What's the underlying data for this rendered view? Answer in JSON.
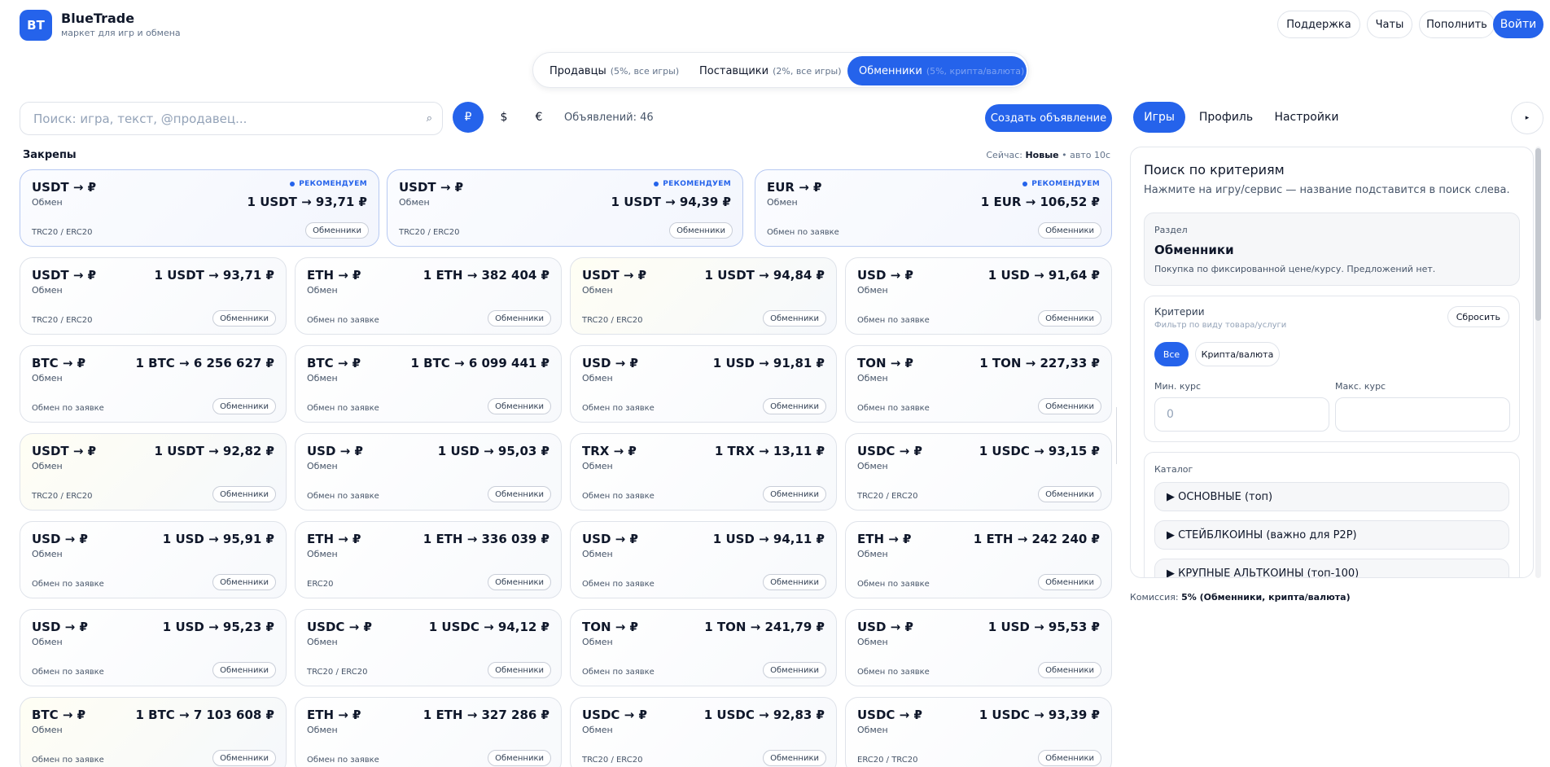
{
  "brand": {
    "logo": "BT",
    "name": "BlueTrade",
    "subtitle": "маркет для игр и обмена"
  },
  "header": {
    "support": "Поддержка",
    "chats": "Чаты",
    "topup": "Пополнить",
    "login": "Войти"
  },
  "modes": [
    {
      "label": "Продавцы",
      "hint": "(5%, все игры)"
    },
    {
      "label": "Поставщики",
      "hint": "(2%, все игры)"
    },
    {
      "label": "Обменники",
      "hint": "(5%, крипта/валюта)"
    }
  ],
  "search": {
    "placeholder": "Поиск: игра, текст, @продавец...",
    "icon": "search-icon"
  },
  "currencies": [
    "₽",
    "$",
    "€"
  ],
  "ads_count": "Объявлений: 46",
  "create_button": "Создать объявление",
  "pins": {
    "title": "Закрепы",
    "now_label": "Сейчас:",
    "sort_value": "Новые",
    "auto": "• авто 10с"
  },
  "recommend_label": "РЕКОМЕНДУЕМ",
  "pinned_cards": [
    {
      "pair": "USDT → ₽",
      "kind": "Обмен",
      "rate": "1 USDT → 93,71 ₽",
      "net": "TRC20 / ERC20",
      "tag": "Обменники"
    },
    {
      "pair": "USDT → ₽",
      "kind": "Обмен",
      "rate": "1 USDT → 94,39 ₽",
      "net": "TRC20 / ERC20",
      "tag": "Обменники"
    },
    {
      "pair": "EUR → ₽",
      "kind": "Обмен",
      "rate": "1 EUR → 106,52 ₽",
      "net": "Обмен по заявке",
      "tag": "Обменники"
    }
  ],
  "cards": [
    {
      "pair": "USDT → ₽",
      "kind": "Обмен",
      "rate": "1 USDT → 93,71 ₽",
      "net": "TRC20 / ERC20",
      "tag": "Обменники",
      "warm": false
    },
    {
      "pair": "ETH → ₽",
      "kind": "Обмен",
      "rate": "1 ETH → 382 404 ₽",
      "net": "Обмен по заявке",
      "tag": "Обменники",
      "warm": false
    },
    {
      "pair": "USDT → ₽",
      "kind": "Обмен",
      "rate": "1 USDT → 94,84 ₽",
      "net": "TRC20 / ERC20",
      "tag": "Обменники",
      "warm": true
    },
    {
      "pair": "USD → ₽",
      "kind": "Обмен",
      "rate": "1 USD → 91,64 ₽",
      "net": "Обмен по заявке",
      "tag": "Обменники",
      "warm": false
    },
    {
      "pair": "BTC → ₽",
      "kind": "Обмен",
      "rate": "1 BTC → 6 256 627 ₽",
      "net": "Обмен по заявке",
      "tag": "Обменники",
      "warm": false
    },
    {
      "pair": "BTC → ₽",
      "kind": "Обмен",
      "rate": "1 BTC → 6 099 441 ₽",
      "net": "Обмен по заявке",
      "tag": "Обменники",
      "warm": false
    },
    {
      "pair": "USD → ₽",
      "kind": "Обмен",
      "rate": "1 USD → 91,81 ₽",
      "net": "Обмен по заявке",
      "tag": "Обменники",
      "warm": false
    },
    {
      "pair": "TON → ₽",
      "kind": "Обмен",
      "rate": "1 TON → 227,33 ₽",
      "net": "Обмен по заявке",
      "tag": "Обменники",
      "warm": false
    },
    {
      "pair": "USDT → ₽",
      "kind": "Обмен",
      "rate": "1 USDT → 92,82 ₽",
      "net": "TRC20 / ERC20",
      "tag": "Обменники",
      "warm": true
    },
    {
      "pair": "USD → ₽",
      "kind": "Обмен",
      "rate": "1 USD → 95,03 ₽",
      "net": "Обмен по заявке",
      "tag": "Обменники",
      "warm": false
    },
    {
      "pair": "TRX → ₽",
      "kind": "Обмен",
      "rate": "1 TRX → 13,11 ₽",
      "net": "Обмен по заявке",
      "tag": "Обменники",
      "warm": false
    },
    {
      "pair": "USDC → ₽",
      "kind": "Обмен",
      "rate": "1 USDC → 93,15 ₽",
      "net": "TRC20 / ERC20",
      "tag": "Обменники",
      "warm": false
    },
    {
      "pair": "USD → ₽",
      "kind": "Обмен",
      "rate": "1 USD → 95,91 ₽",
      "net": "Обмен по заявке",
      "tag": "Обменники",
      "warm": false
    },
    {
      "pair": "ETH → ₽",
      "kind": "Обмен",
      "rate": "1 ETH → 336 039 ₽",
      "net": "ERC20",
      "tag": "Обменники",
      "warm": false
    },
    {
      "pair": "USD → ₽",
      "kind": "Обмен",
      "rate": "1 USD → 94,11 ₽",
      "net": "Обмен по заявке",
      "tag": "Обменники",
      "warm": false
    },
    {
      "pair": "ETH → ₽",
      "kind": "Обмен",
      "rate": "1 ETH → 242 240 ₽",
      "net": "Обмен по заявке",
      "tag": "Обменники",
      "warm": false
    },
    {
      "pair": "USD → ₽",
      "kind": "Обмен",
      "rate": "1 USD → 95,23 ₽",
      "net": "Обмен по заявке",
      "tag": "Обменники",
      "warm": false
    },
    {
      "pair": "USDC → ₽",
      "kind": "Обмен",
      "rate": "1 USDC → 94,12 ₽",
      "net": "TRC20 / ERC20",
      "tag": "Обменники",
      "warm": false
    },
    {
      "pair": "TON → ₽",
      "kind": "Обмен",
      "rate": "1 TON → 241,79 ₽",
      "net": "Обмен по заявке",
      "tag": "Обменники",
      "warm": false
    },
    {
      "pair": "USD → ₽",
      "kind": "Обмен",
      "rate": "1 USD → 95,53 ₽",
      "net": "Обмен по заявке",
      "tag": "Обменники",
      "warm": false
    },
    {
      "pair": "BTC → ₽",
      "kind": "Обмен",
      "rate": "1 BTC → 7 103 608 ₽",
      "net": "Обмен по заявке",
      "tag": "Обменники",
      "warm": true
    },
    {
      "pair": "ETH → ₽",
      "kind": "Обмен",
      "rate": "1 ETH → 327 286 ₽",
      "net": "Обмен по заявке",
      "tag": "Обменники",
      "warm": false
    },
    {
      "pair": "USDC → ₽",
      "kind": "Обмен",
      "rate": "1 USDC → 92,83 ₽",
      "net": "TRC20 / ERC20",
      "tag": "Обменники",
      "warm": false
    },
    {
      "pair": "USDC → ₽",
      "kind": "Обмен",
      "rate": "1 USDC → 93,39 ₽",
      "net": "ERC20 / TRC20",
      "tag": "Обменники",
      "warm": false
    }
  ],
  "right_tabs": [
    "Игры",
    "Профиль",
    "Настройки"
  ],
  "right_arrow": "▸",
  "panel": {
    "title": "Поиск по критериям",
    "subtitle": "Нажмите на игру/сервис — название подставится в поиск слева.",
    "section_label": "Раздел",
    "section_value": "Обменники",
    "section_note": "Покупка по фиксированной цене/курсу. Предложений нет.",
    "criteria_title": "Критерии",
    "criteria_sub": "Фильтр по виду товара/услуги",
    "reset": "Сбросить",
    "chips": [
      "Все",
      "Крипта/валюта"
    ],
    "min_label": "Мин. курс",
    "max_label": "Макс. курс",
    "min_placeholder": "0",
    "max_placeholder": "",
    "catalog_title": "Каталог",
    "catalog": [
      "▶ ОСНОВНЫЕ (топ)",
      "▶ СТЕЙБЛКОИНЫ (важно для P2P)",
      "▶ КРУПНЫЕ АЛЬТКОИНЫ (топ-100)"
    ]
  },
  "commission": {
    "label": "Комиссия:",
    "value": "5% (Обменники, крипта/валюта)"
  },
  "colors": {
    "accent": "#2563eb",
    "border": "#dfe3ea",
    "text": "#0f172a",
    "muted": "#64748b"
  }
}
